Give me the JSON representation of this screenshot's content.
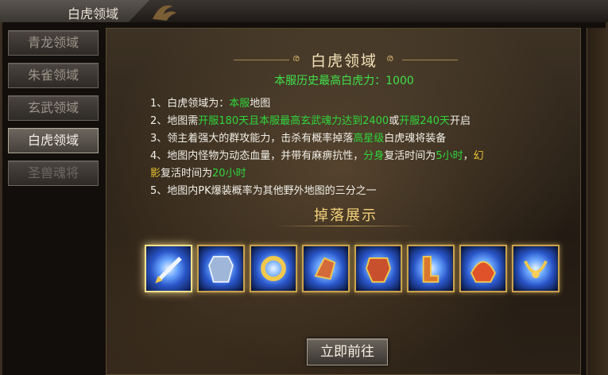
{
  "window": {
    "title": "白虎领域"
  },
  "sidebar": {
    "items": [
      {
        "label": "青龙领域",
        "state": "normal"
      },
      {
        "label": "朱雀领域",
        "state": "normal"
      },
      {
        "label": "玄武领域",
        "state": "normal"
      },
      {
        "label": "白虎领域",
        "state": "active"
      },
      {
        "label": "圣兽魂将",
        "state": "disabled"
      }
    ]
  },
  "main": {
    "heading": "白虎领域",
    "subtitle": "本服历史最高白虎力：1000",
    "rules": [
      {
        "parts": [
          {
            "t": "1、白虎领域为："
          },
          {
            "t": "本服",
            "c": "g"
          },
          {
            "t": "地图"
          }
        ]
      },
      {
        "parts": [
          {
            "t": "2、地图需"
          },
          {
            "t": "开服180天且本服最高玄武魂力达到2400",
            "c": "g"
          },
          {
            "t": "或"
          },
          {
            "t": "开服240天",
            "c": "g"
          },
          {
            "t": "开启"
          }
        ]
      },
      {
        "parts": [
          {
            "t": "3、领主着强大的群攻能力，击杀有概率掉落"
          },
          {
            "t": "高星级",
            "c": "g"
          },
          {
            "t": "白虎魂将装备"
          }
        ]
      },
      {
        "parts": [
          {
            "t": "4、地图内怪物为动态血量，并带有麻痹抗性，"
          },
          {
            "t": "分身",
            "c": "g"
          },
          {
            "t": "复活时间为"
          },
          {
            "t": "5小时",
            "c": "g"
          },
          {
            "t": "，"
          },
          {
            "t": "幻",
            "c": "y"
          }
        ]
      },
      {
        "parts": [
          {
            "t": "影",
            "c": "y"
          },
          {
            "t": "复活时间为"
          },
          {
            "t": "20小时",
            "c": "g"
          }
        ]
      },
      {
        "parts": [
          {
            "t": "5、地图内PK爆装概率为其他野外地图的三分之一"
          }
        ]
      }
    ],
    "drops_title": "掉落展示",
    "drops": [
      {
        "icon": "blade-weapon-icon"
      },
      {
        "icon": "armor-icon"
      },
      {
        "icon": "ring-bracelet-icon"
      },
      {
        "icon": "gauntlet-icon"
      },
      {
        "icon": "chest-armor-icon"
      },
      {
        "icon": "boots-icon"
      },
      {
        "icon": "helmet-icon"
      },
      {
        "icon": "necklace-icon"
      }
    ],
    "go_button": "立即前往"
  },
  "colors": {
    "accent_green": "#2fd63c",
    "accent_yellow": "#e9c230",
    "title_gold": "#f3e3b8"
  }
}
